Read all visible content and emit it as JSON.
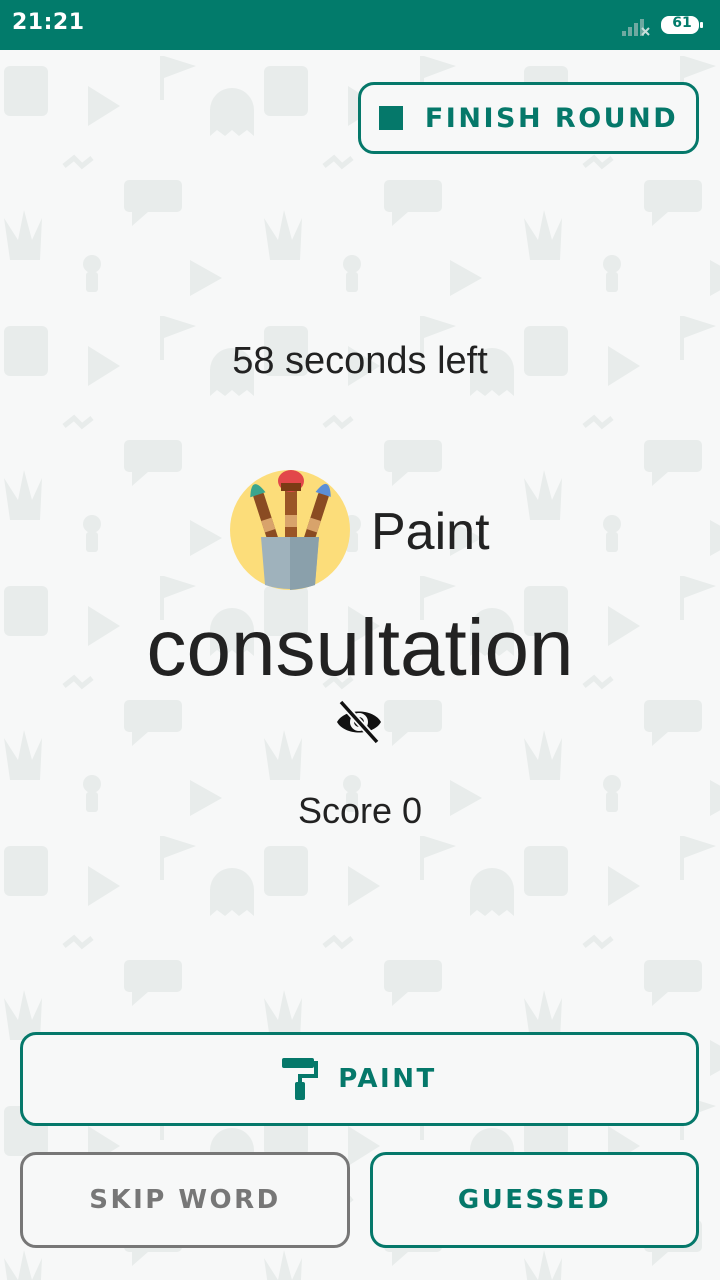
{
  "status_bar": {
    "time": "21:21",
    "battery_level": "61",
    "background_color": "#027b6b"
  },
  "game": {
    "timer_text": "58 seconds left",
    "category_icon": "paint-brushes-icon",
    "category_label": "Paint",
    "secret_word": "consultation",
    "visibility_icon": "eye-off-icon",
    "score_text": "Score 0"
  },
  "buttons": {
    "finish_round_label": "FINISH ROUND",
    "paint_label": "PAINT",
    "skip_word_label": "SKIP WORD",
    "guessed_label": "GUESSED"
  },
  "colors": {
    "accent": "#05786a",
    "muted": "#777777",
    "text": "#222222",
    "background": "#f7f8f8"
  }
}
